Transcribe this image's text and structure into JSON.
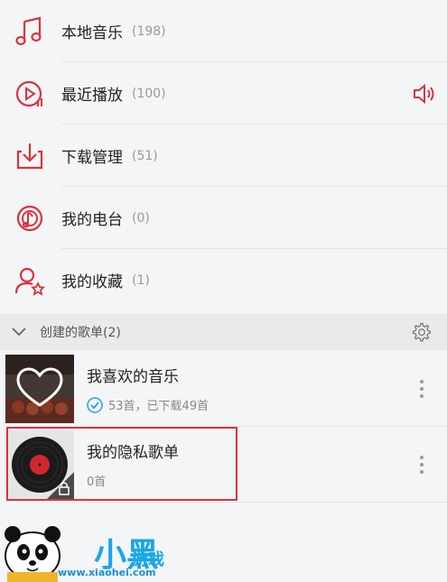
{
  "menu": [
    {
      "label": "本地音乐",
      "count": "(198)",
      "icon": "music-note-icon"
    },
    {
      "label": "最近播放",
      "count": "(100)",
      "icon": "recent-play-icon"
    },
    {
      "label": "下载管理",
      "count": "(51)",
      "icon": "download-icon"
    },
    {
      "label": "我的电台",
      "count": "(0)",
      "icon": "radio-icon"
    },
    {
      "label": "我的收藏",
      "count": "(1)",
      "icon": "favorite-user-icon"
    }
  ],
  "section": {
    "title": "创建的歌单(2)"
  },
  "playlists": [
    {
      "name": "我喜欢的音乐",
      "sub": "53首，已下载49首",
      "cover": "heart-cover"
    },
    {
      "name": "我的隐私歌单",
      "sub": "0首",
      "cover": "vinyl-lock-cover"
    }
  ],
  "watermark": {
    "text": "小黑",
    "text2": "游戏",
    "url": "www.xiaohei.com"
  },
  "colors": {
    "accent": "#d8343e",
    "background": "#f4f5f6",
    "section_bg": "#e9eaeb",
    "check": "#2aa0e0"
  }
}
